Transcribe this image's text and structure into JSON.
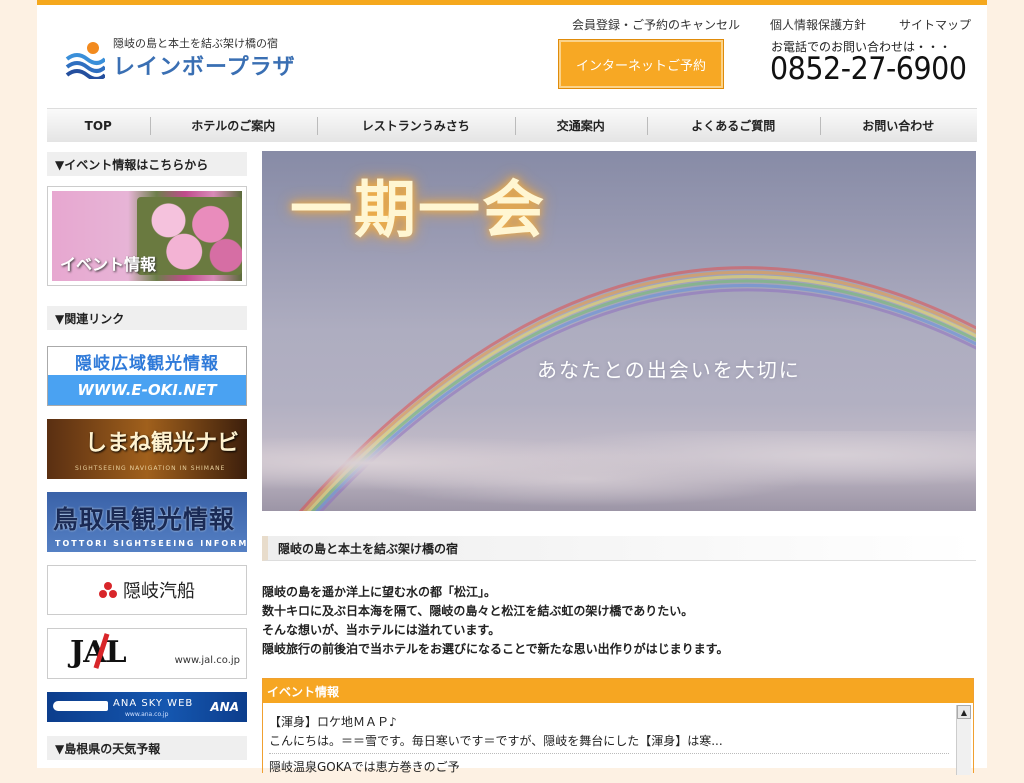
{
  "header": {
    "tagline": "隠岐の島と本土を結ぶ架け橋の宿",
    "site_name": "レインボープラザ",
    "top_links": [
      "会員登録・ご予約のキャンセル",
      "個人情報保護方針",
      "サイトマップ"
    ],
    "booking_button": "インターネットご予約",
    "phone_label": "お電話でのお問い合わせは・・・",
    "phone_number": "0852-27-6900"
  },
  "nav": {
    "items": [
      "TOP",
      "ホテルのご案内",
      "レストランうみさち",
      "交通案内",
      "よくあるご質問",
      "お問い合わせ"
    ]
  },
  "sidebar": {
    "event_heading": "▼イベント情報はこちらから",
    "event_banner_label": "イベント情報",
    "links_heading": "▼関連リンク",
    "banners": {
      "oki_title": "隠岐広域観光情報",
      "oki_url": "WWW.E-OKI.NET",
      "shimane_title": "しまね観光ナビ",
      "shimane_sub": "SIGHTSEEING NAVIGATION IN SHIMANE",
      "tottori_title": "鳥取県観光情報",
      "tottori_sub": "TOTTORI SIGHTSEEING INFORMATION",
      "kisen_name": "隠岐汽船",
      "jal_logo": "JAL",
      "jal_url": "www.jal.co.jp",
      "ana_title": "ANA SKY WEB",
      "ana_url": "www.ana.co.jp",
      "ana_logo": "ANA"
    },
    "weather_heading": "▼島根県の天気予報"
  },
  "hero": {
    "title": "一期一会",
    "subtitle": "あなたとの出会いを大切に"
  },
  "main": {
    "section_heading": "隠岐の島と本土を結ぶ架け橋の宿",
    "intro_lines": [
      "隠岐の島を遥か洋上に望む水の都「松江」。",
      "数十キロに及ぶ日本海を隔て、隠岐の島々と松江を結ぶ虹の架け橋でありたい。",
      "そんな想いが、当ホテルには溢れています。",
      "隠岐旅行の前後泊で当ホテルをお選びになることで新たな思い出作りがはじまります。"
    ],
    "event_box": {
      "title": "イベント情報",
      "entries": [
        {
          "title": "【渾身】ロケ地ＭＡＰ♪",
          "excerpt": "こんにちは。＝＝雪です。毎日寒いです＝ですが、隠岐を舞台にした【渾身】は寒..."
        },
        {
          "title": "隠岐温泉GOKAでは恵方巻きのご予",
          "excerpt": ""
        }
      ]
    }
  },
  "colors": {
    "accent_orange": "#f6a622",
    "logo_blue": "#3a6fb3",
    "background": "#fdf1e3"
  },
  "icons": [
    "rainbow-wave-logo-icon",
    "scroll-up-arrow-icon",
    "scroll-down-arrow-icon"
  ]
}
